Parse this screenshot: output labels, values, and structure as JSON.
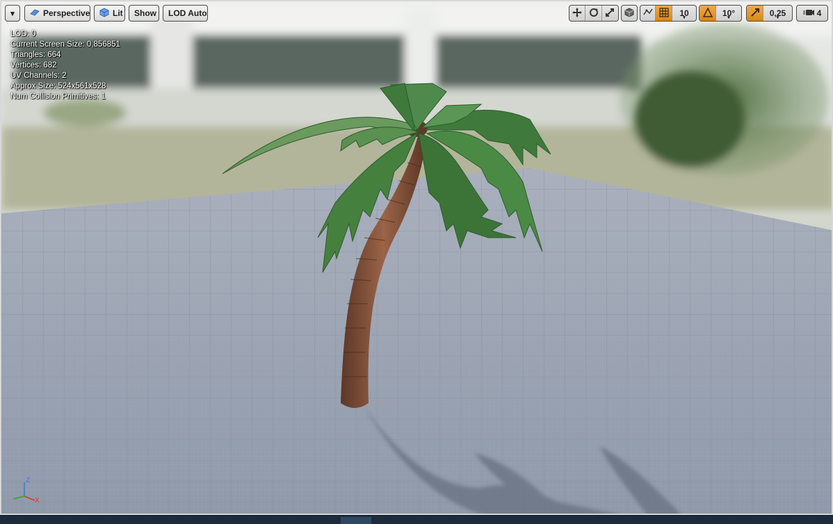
{
  "toolbar": {
    "menu_arrow": "▾",
    "perspective_label": "Perspective",
    "lit_label": "Lit",
    "show_label": "Show",
    "lod_label": "LOD Auto",
    "grid_snap_value": "10",
    "rotation_snap_value": "10°",
    "scale_snap_value": "0,25",
    "camera_speed_value": "4"
  },
  "stats": {
    "lod": "LOD:  0",
    "screen_size": "Current Screen Size:  0,856851",
    "triangles": "Triangles:  664",
    "vertices": "Vertices:  682",
    "uv_channels": "UV Channels:  2",
    "approx_size": "Approx Size:  524x561x528",
    "collision": "Num Collision Primitives:  1"
  },
  "axis": {
    "z": "Z",
    "x": "X"
  },
  "colors": {
    "accent": "#e38f1e",
    "floor": "#9aa3b3",
    "trunk": "#7a4d34",
    "leaf": "#3f7a3c"
  }
}
